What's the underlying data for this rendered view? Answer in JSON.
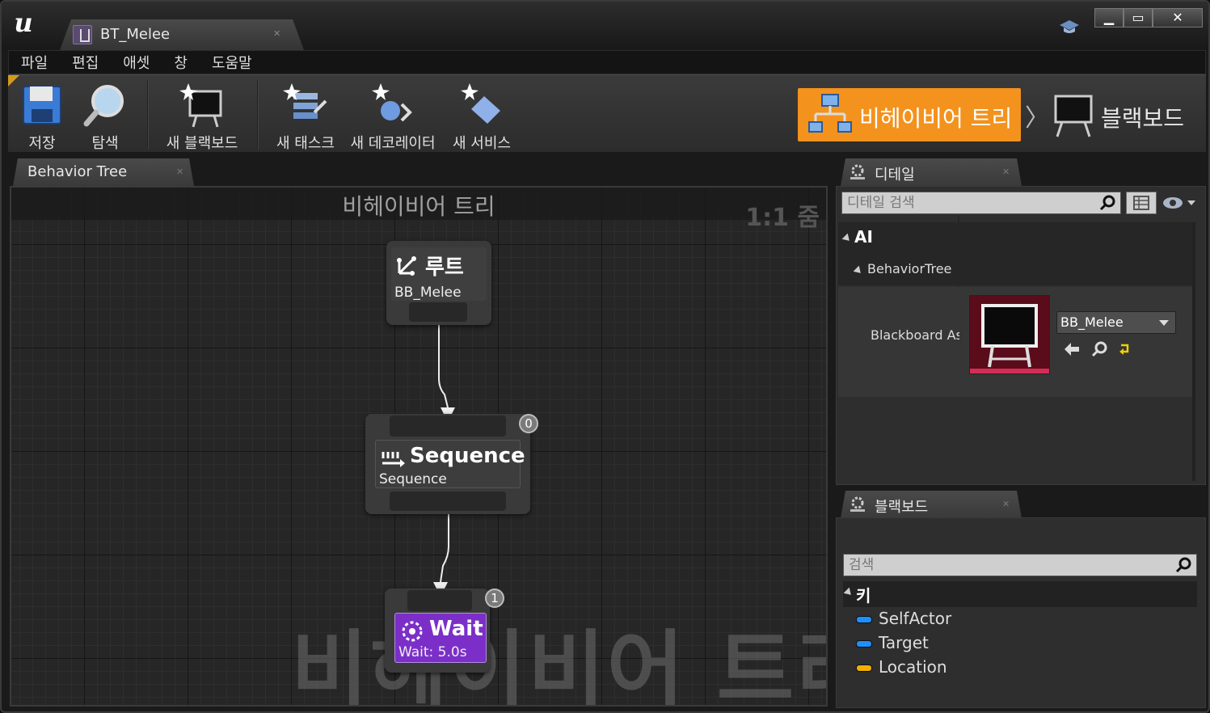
{
  "app": {
    "document_tab": "BT_Melee",
    "window_buttons": {
      "minimize": "▁",
      "maximize": "▭",
      "close": "✕"
    }
  },
  "menu": [
    "파일",
    "편집",
    "애셋",
    "창",
    "도움말"
  ],
  "toolbar": {
    "save": "저장",
    "browse": "탐색",
    "new_blackboard": "새 블랙보드",
    "new_task": "새 태스크",
    "new_decorator": "새 데코레이터",
    "new_service": "새 서비스"
  },
  "modes": {
    "behavior_tree": "비헤이비어 트리",
    "blackboard": "블랙보드",
    "active_color": "#f3921d"
  },
  "graph_panel": {
    "tab_label": "Behavior Tree",
    "header_title": "비헤이비어 트리",
    "zoom": "1:1 줌",
    "watermark": "비헤이비어 트리",
    "nodes": {
      "root": {
        "title": "루트",
        "subtitle": "BB_Melee"
      },
      "sequence": {
        "title": "Sequence",
        "subtitle": "Sequence",
        "index": "0"
      },
      "wait": {
        "title": "Wait",
        "subtitle": "Wait: 5.0s",
        "index": "1",
        "color": "#7b2fc8"
      }
    }
  },
  "details_panel": {
    "tab_label": "디테일",
    "search_placeholder": "디테일 검색",
    "category_ai": "AI",
    "subcategory": "BehaviorTree",
    "property_name": "Blackboard Ass",
    "asset_value": "BB_Melee"
  },
  "blackboard_panel": {
    "tab_label": "블랙보드",
    "search_placeholder": "검색",
    "keys_header": "키",
    "keys": [
      {
        "name": "SelfActor",
        "color": "#1e90ff"
      },
      {
        "name": "Target",
        "color": "#1e90ff"
      },
      {
        "name": "Location",
        "color": "#f0b000"
      }
    ]
  }
}
